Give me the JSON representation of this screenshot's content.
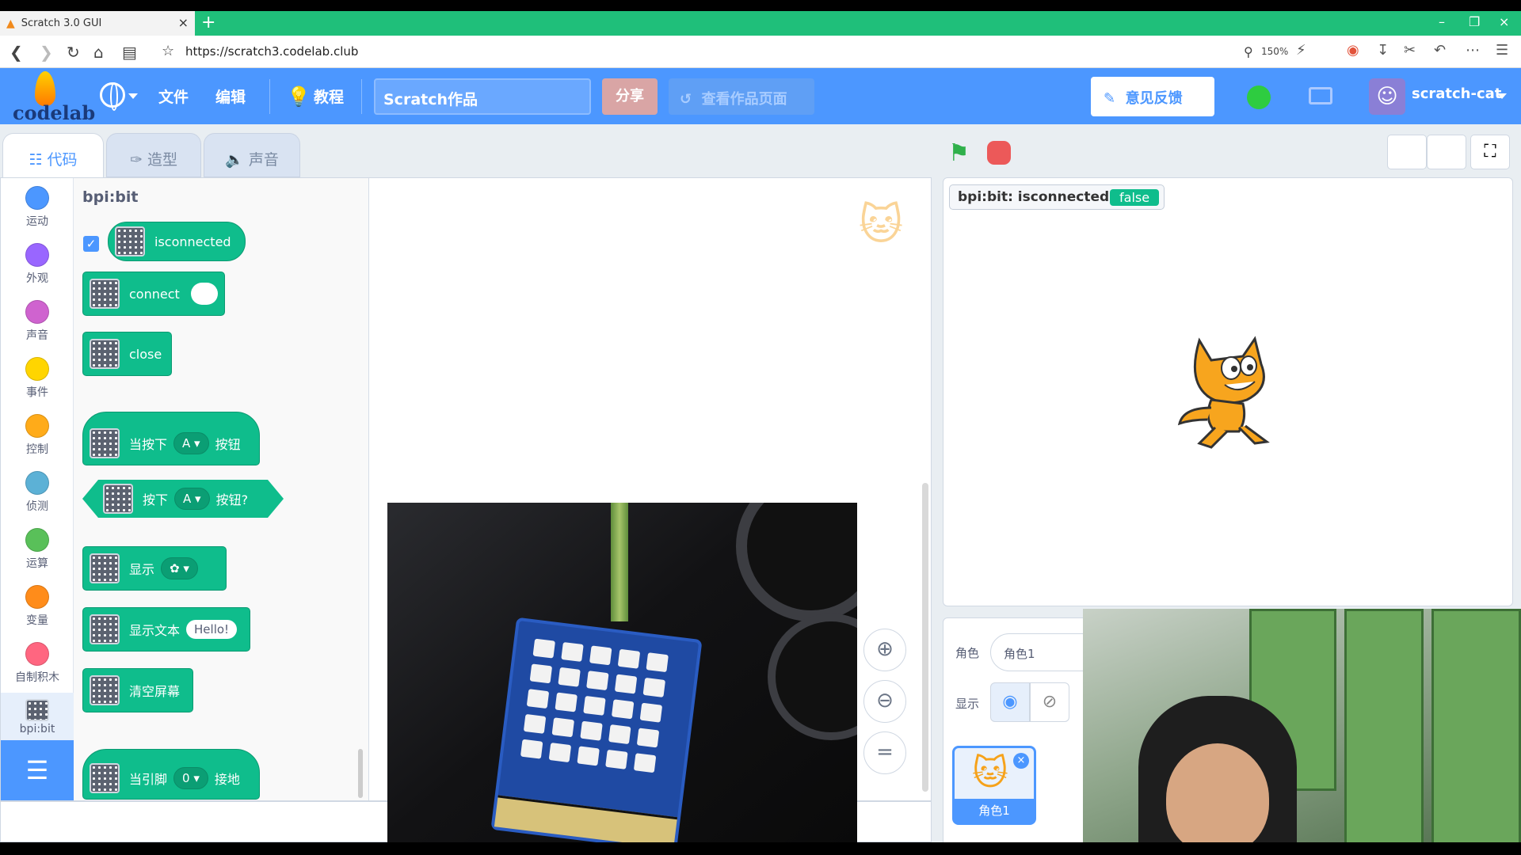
{
  "browser": {
    "tab_title": "Scratch 3.0 GUI",
    "url": "https://scratch3.codelab.club",
    "zoom": "150%"
  },
  "menubar": {
    "logo_text": "codelab",
    "file": "文件",
    "edit": "编辑",
    "tutorials": "教程",
    "project_title": "Scratch作品",
    "share": "分享",
    "see_project_page": "查看作品页面",
    "feedback": "意见反馈",
    "username": "scratch-cat"
  },
  "editor_tabs": {
    "code": "代码",
    "costumes": "造型",
    "sounds": "声音"
  },
  "categories": [
    {
      "label": "运动",
      "color": "#4c97ff"
    },
    {
      "label": "外观",
      "color": "#9966ff"
    },
    {
      "label": "声音",
      "color": "#cf63cf"
    },
    {
      "label": "事件",
      "color": "#ffd500"
    },
    {
      "label": "控制",
      "color": "#ffab19"
    },
    {
      "label": "侦测",
      "color": "#5cb1d6"
    },
    {
      "label": "运算",
      "color": "#59c059"
    },
    {
      "label": "变量",
      "color": "#ff8c1a"
    },
    {
      "label": "自制积木",
      "color": "#ff6680"
    },
    {
      "label": "bpi:bit",
      "color": "#0fbd8c"
    }
  ],
  "palette": {
    "title": "bpi:bit",
    "blocks": {
      "isconnected": "isconnected",
      "connect": "connect",
      "close": "close",
      "when_pressed": "当按下",
      "button_a": "A",
      "button_suffix": "按钮",
      "pressed": "按下",
      "button_q": "按钮?",
      "display": "显示",
      "display_text": "显示文本",
      "hello": "Hello!",
      "clear_screen": "清空屏幕",
      "when_pin": "当引脚",
      "pin_value": "0",
      "ground": "接地"
    }
  },
  "stage": {
    "monitor_label": "bpi:bit: isconnected",
    "monitor_value": "false"
  },
  "sprite_pane": {
    "sprite_label": "角色",
    "sprite_name": "角色1",
    "show_label": "显示",
    "tile_name": "角色1"
  }
}
